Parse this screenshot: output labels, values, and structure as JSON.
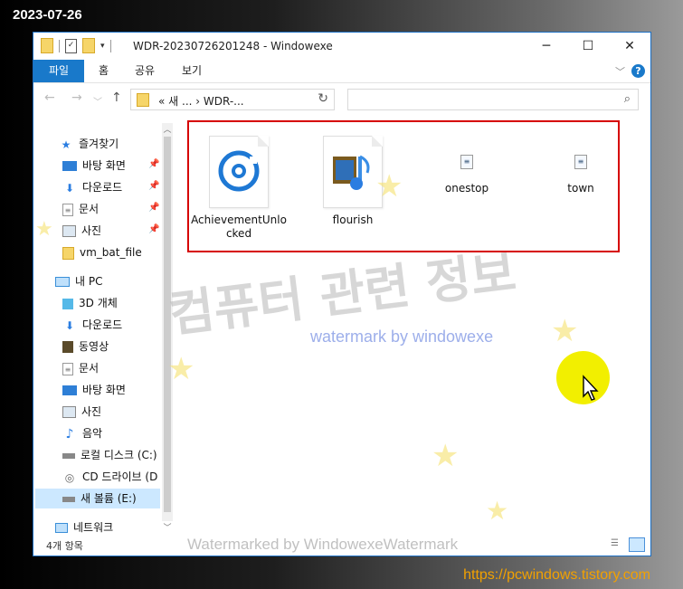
{
  "date_stamp": "2023-07-26",
  "site_url": "https://pcwindows.tistory.com",
  "window": {
    "title": "WDR-20230726201248 - Windowexe",
    "controls": {
      "minimize": "─",
      "maximize": "☐",
      "close": "✕"
    }
  },
  "ribbon": {
    "tabs": [
      "파일",
      "홈",
      "공유",
      "보기"
    ],
    "collapse_icon": "chevron-down-icon",
    "help": "?"
  },
  "address": {
    "crumb": "« 새 ...  ›  WDR-...",
    "back": "←",
    "forward": "→",
    "up": "↑",
    "refresh": "↻",
    "search_placeholder": ""
  },
  "nav": {
    "items": [
      {
        "label": "즐겨찾기",
        "icon": "star-icon"
      },
      {
        "label": "바탕 화면",
        "icon": "desktop-icon",
        "pinned": true
      },
      {
        "label": "다운로드",
        "icon": "download-icon",
        "pinned": true
      },
      {
        "label": "문서",
        "icon": "document-icon",
        "pinned": true
      },
      {
        "label": "사진",
        "icon": "pictures-icon",
        "pinned": true
      },
      {
        "label": "vm_bat_file",
        "icon": "folder-icon"
      },
      {
        "label": "내 PC",
        "icon": "pc-icon"
      },
      {
        "label": "3D 개체",
        "icon": "cube-icon"
      },
      {
        "label": "다운로드",
        "icon": "download-icon"
      },
      {
        "label": "동영상",
        "icon": "video-icon"
      },
      {
        "label": "문서",
        "icon": "document-icon"
      },
      {
        "label": "바탕 화면",
        "icon": "desktop-icon"
      },
      {
        "label": "사진",
        "icon": "pictures-icon"
      },
      {
        "label": "음악",
        "icon": "music-icon"
      },
      {
        "label": "로컬 디스크 (C:)",
        "icon": "disk-icon"
      },
      {
        "label": "CD 드라이브 (D",
        "icon": "cd-icon"
      },
      {
        "label": "새 볼륨 (E:)",
        "icon": "disk-icon",
        "selected": true
      },
      {
        "label": "네트워크",
        "icon": "network-icon"
      }
    ]
  },
  "files": [
    {
      "name": "AchievementUnlocked",
      "icon": "sound-file-icon"
    },
    {
      "name": "flourish",
      "icon": "midi-file-icon"
    },
    {
      "name": "onestop",
      "icon": "small-file-icon"
    },
    {
      "name": "town",
      "icon": "small-file-icon"
    }
  ],
  "watermarks": {
    "korean": "컴퓨터 관련 정보",
    "english": "watermark by windowexe",
    "footer": "Watermarked by WindowexeWatermark"
  },
  "status": {
    "item_count": "4개 항목"
  },
  "colors": {
    "accent": "#1979ca",
    "selection": "#d60000",
    "cursor_highlight": "#f2ef00"
  }
}
